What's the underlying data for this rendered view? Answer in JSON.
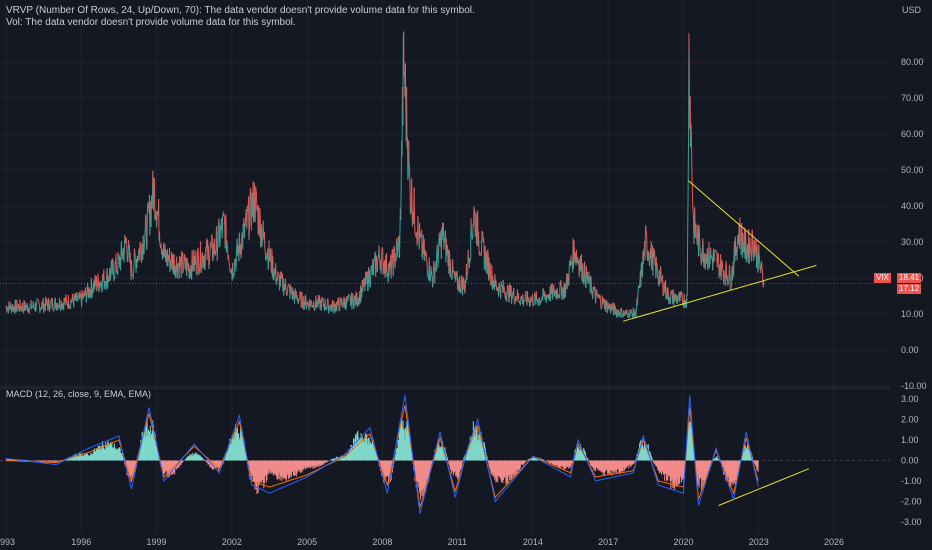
{
  "indicator_notes": {
    "vrvp": "VRVP (Number Of Rows, 24, Up/Down, 70): The data vendor doesn't provide volume data for this symbol.",
    "vol": "Vol: The data vendor doesn't provide volume data for this symbol."
  },
  "macd_label": "MACD (12, 26, close, 9, EMA, EMA)",
  "price_axis": {
    "currency": "USD"
  },
  "badges": {
    "symbol": "VIX",
    "last": "18.41",
    "other": "17.12"
  },
  "colors": {
    "background": "#141823",
    "up": "#26a69a",
    "down": "#ef5350",
    "trendline": "#e6e22a",
    "macd": "#2962ff",
    "signal": "#ff6d00"
  },
  "chart_data": [
    {
      "type": "line",
      "title": "",
      "xlabel": "",
      "ylabel": "",
      "x_ticks": [
        "993",
        "1996",
        "1999",
        "2002",
        "2005",
        "2008",
        "2011",
        "2014",
        "2017",
        "2020",
        "2023",
        "2026"
      ],
      "y_ticks": [
        "-10.00",
        "0.00",
        "10.00",
        "20.00",
        "30.00",
        "40.00",
        "50.00",
        "60.00",
        "70.00",
        "80.00"
      ],
      "ylim": [
        -10,
        95
      ],
      "series": [
        {
          "name": "",
          "x": [
            1993.0,
            1994.0,
            1995.0,
            1996.0,
            1996.5,
            1997.0,
            1997.5,
            1997.8,
            1998.0,
            1998.6,
            1998.9,
            1999.3,
            1999.8,
            2000.3,
            2000.8,
            2001.3,
            2001.7,
            2002.0,
            2002.6,
            2002.9,
            2003.3,
            2003.8,
            2004.5,
            2005.0,
            2005.5,
            2006.0,
            2006.4,
            2007.0,
            2007.6,
            2007.9,
            2008.3,
            2008.7,
            2008.85,
            2009.1,
            2009.5,
            2010.0,
            2010.4,
            2010.9,
            2011.3,
            2011.65,
            2011.9,
            2012.5,
            2013.0,
            2013.6,
            2014.2,
            2014.8,
            2015.3,
            2015.65,
            2016.0,
            2016.5,
            2017.0,
            2017.6,
            2018.1,
            2018.5,
            2018.95,
            2019.4,
            2019.9,
            2020.15,
            2020.22,
            2020.4,
            2020.7,
            2021.0,
            2021.3,
            2021.6,
            2021.9,
            2022.2,
            2022.5,
            2022.8,
            2023.0,
            2023.2
          ],
          "values": [
            12,
            12,
            13,
            14,
            18,
            20,
            24,
            30,
            22,
            33,
            45,
            26,
            24,
            23,
            26,
            28,
            35,
            22,
            35,
            42,
            30,
            20,
            15,
            13,
            13,
            12,
            13,
            14,
            22,
            26,
            22,
            30,
            81,
            45,
            30,
            20,
            32,
            19,
            18,
            38,
            30,
            18,
            16,
            14,
            14,
            16,
            17,
            28,
            22,
            15,
            12,
            10,
            10,
            30,
            22,
            15,
            14,
            14,
            82,
            35,
            28,
            26,
            25,
            22,
            20,
            33,
            28,
            30,
            25,
            19
          ]
        }
      ]
    },
    {
      "type": "bar",
      "title": "",
      "y_ticks": [
        "-3.00",
        "-2.00",
        "-1.00",
        "0.00",
        "1.00",
        "2.00",
        "3.00"
      ],
      "ylim": [
        -3.3,
        3.3
      ],
      "x": [
        1993.0,
        1995.0,
        1996.3,
        1997.5,
        1998.0,
        1998.7,
        1999.3,
        2000.5,
        2001.5,
        2002.3,
        2002.8,
        2003.5,
        2005.0,
        2006.5,
        2007.5,
        2008.2,
        2008.9,
        2009.5,
        2010.3,
        2010.9,
        2011.4,
        2011.8,
        2012.5,
        2014.0,
        2015.5,
        2015.8,
        2016.5,
        2018.0,
        2018.4,
        2019.0,
        2020.0,
        2020.25,
        2020.6,
        2021.3,
        2022.0,
        2022.5,
        2023.0
      ],
      "histogram": [
        0.1,
        -0.1,
        0.5,
        1.0,
        -1.5,
        2.8,
        -1.2,
        0.6,
        -0.8,
        2.4,
        -1.6,
        -1.0,
        -0.6,
        0.4,
        1.8,
        -2.0,
        3.0,
        -2.8,
        1.6,
        -1.4,
        0.8,
        2.2,
        -1.6,
        0.3,
        -0.6,
        1.2,
        -0.8,
        -0.4,
        1.4,
        -0.8,
        -1.4,
        3.0,
        -2.0,
        0.4,
        -1.8,
        1.2,
        -0.9
      ],
      "macd": [
        0.1,
        -0.2,
        0.6,
        1.2,
        -1.4,
        2.6,
        -1.0,
        0.8,
        -0.6,
        2.2,
        -1.2,
        -1.6,
        -0.8,
        0.3,
        1.6,
        -1.6,
        3.2,
        -2.6,
        1.4,
        -1.8,
        0.6,
        2.0,
        -2.0,
        0.2,
        -0.8,
        1.0,
        -1.0,
        -0.6,
        1.2,
        -1.2,
        -1.6,
        3.2,
        -2.2,
        0.6,
        -1.9,
        1.4,
        -1.4
      ],
      "signal": [
        0.0,
        -0.1,
        0.4,
        1.0,
        -1.0,
        2.3,
        -0.8,
        0.7,
        -0.4,
        1.9,
        -1.0,
        -1.3,
        -0.7,
        0.2,
        1.3,
        -1.2,
        2.7,
        -2.3,
        1.1,
        -1.5,
        0.5,
        1.7,
        -1.8,
        0.2,
        -0.6,
        0.8,
        -0.8,
        -0.5,
        1.0,
        -1.0,
        -1.3,
        2.6,
        -1.9,
        0.5,
        -1.6,
        1.1,
        -1.1
      ]
    }
  ]
}
